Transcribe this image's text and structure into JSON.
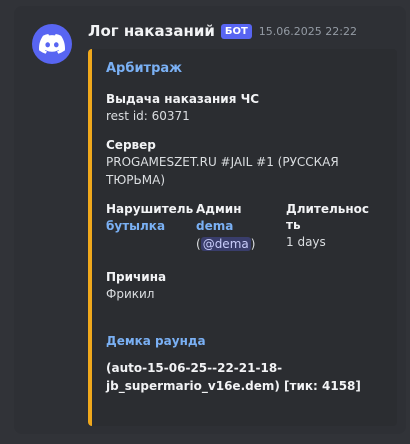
{
  "message": {
    "author": "Лог наказаний",
    "bot_tag": "БОТ",
    "timestamp": "15.06.2025 22:22"
  },
  "embed": {
    "accent_color": "#f0a81c",
    "title": "Арбитраж",
    "punishment": {
      "title": "Выдача наказания ЧС",
      "rest_id": "rest id: 60371"
    },
    "server": {
      "name": "Сервер",
      "value_line1": "PROGAMESZET.RU #JAIL #1 (РУССКАЯ",
      "value_line2": "ТЮРЬМА)"
    },
    "violator": {
      "name": "Нарушитель",
      "value": "бутылка"
    },
    "admin": {
      "name": "Админ",
      "value": "dema",
      "mention_open": "(",
      "mention": "@dema",
      "mention_close": ")"
    },
    "duration": {
      "name_line1": "Длительнос",
      "name_line2": "ть",
      "value": "1 days"
    },
    "reason": {
      "name": "Причина",
      "value": "Фрикил"
    },
    "demo": {
      "link": "Демка раунда",
      "line1": "(auto-15-06-25--22-21-18-",
      "line2": "jb_supermario_v16e.dem) [тик: 4158]"
    }
  },
  "icons": {
    "avatar": "discord-logo-icon"
  }
}
